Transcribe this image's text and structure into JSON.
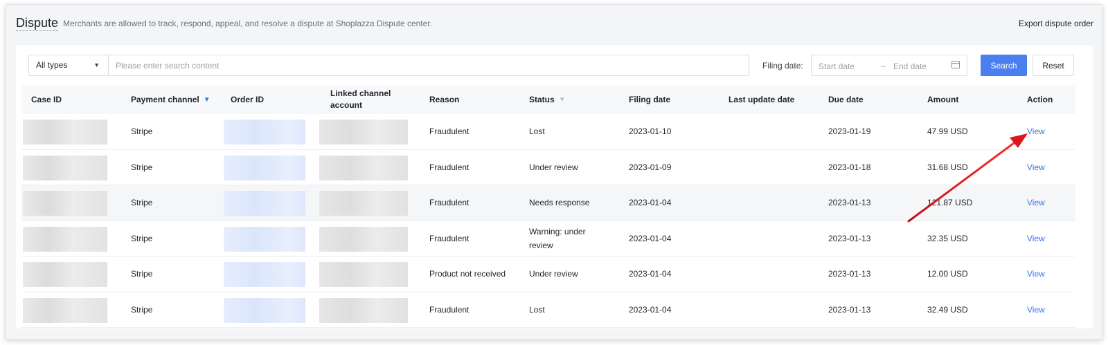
{
  "header": {
    "title": "Dispute",
    "description": "Merchants are allowed to track, respond, appeal, and resolve a dispute at Shoplazza Dispute center.",
    "export_label": "Export dispute order"
  },
  "filters": {
    "type_select": "All types",
    "search_placeholder": "Please enter search content",
    "filing_date_label": "Filing date:",
    "start_date_placeholder": "Start date",
    "date_separator": "–",
    "end_date_placeholder": "End date",
    "search_button": "Search",
    "reset_button": "Reset"
  },
  "table": {
    "columns": [
      "Case ID",
      "Payment channel",
      "Order ID",
      "Linked channel account",
      "Reason",
      "Status",
      "Filing date",
      "Last update date",
      "Due date",
      "Amount",
      "Action"
    ],
    "rows": [
      {
        "payment_channel": "Stripe",
        "reason": "Fraudulent",
        "status": "Lost",
        "filing_date": "2023-01-10",
        "last_update": "",
        "due_date": "2023-01-19",
        "amount": "47.99 USD",
        "action": "View"
      },
      {
        "payment_channel": "Stripe",
        "reason": "Fraudulent",
        "status": "Under review",
        "filing_date": "2023-01-09",
        "last_update": "",
        "due_date": "2023-01-18",
        "amount": "31.68 USD",
        "action": "View"
      },
      {
        "payment_channel": "Stripe",
        "reason": "Fraudulent",
        "status": "Needs response",
        "filing_date": "2023-01-04",
        "last_update": "",
        "due_date": "2023-01-13",
        "amount": "121.87 USD",
        "action": "View"
      },
      {
        "payment_channel": "Stripe",
        "reason": "Fraudulent",
        "status": "Warning: under review",
        "filing_date": "2023-01-04",
        "last_update": "",
        "due_date": "2023-01-13",
        "amount": "32.35 USD",
        "action": "View"
      },
      {
        "payment_channel": "Stripe",
        "reason": "Product not received",
        "status": "Under review",
        "filing_date": "2023-01-04",
        "last_update": "",
        "due_date": "2023-01-13",
        "amount": "12.00 USD",
        "action": "View"
      },
      {
        "payment_channel": "Stripe",
        "reason": "Fraudulent",
        "status": "Lost",
        "filing_date": "2023-01-04",
        "last_update": "",
        "due_date": "2023-01-13",
        "amount": "32.49 USD",
        "action": "View"
      }
    ]
  },
  "icons": {
    "payment_channel_filter": "filter-icon",
    "status_filter": "filter-icon",
    "date_picker": "calendar-icon",
    "type_caret": "caret-down-icon"
  },
  "colors": {
    "accent": "#4a7ff0",
    "link": "#3b74e8",
    "annotation_arrow": "#e0141e"
  }
}
